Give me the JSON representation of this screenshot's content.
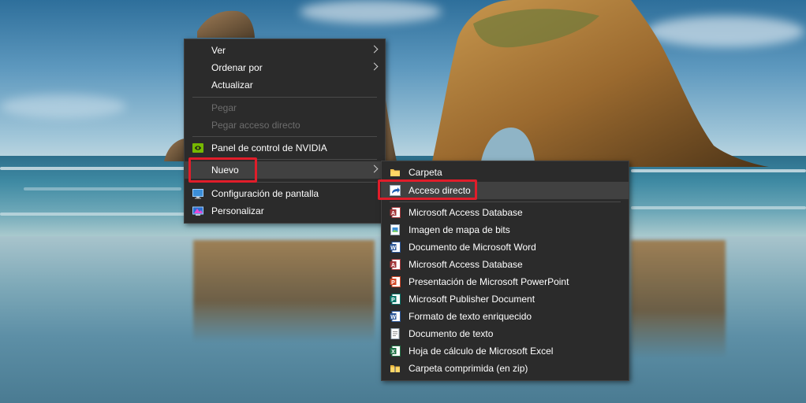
{
  "context_menu": {
    "items": [
      {
        "label": "Ver",
        "submenu": true
      },
      {
        "label": "Ordenar por",
        "submenu": true
      },
      {
        "label": "Actualizar"
      },
      {
        "label": "Pegar",
        "disabled": true
      },
      {
        "label": "Pegar acceso directo",
        "disabled": true
      },
      {
        "label": "Panel de control de NVIDIA",
        "icon": "nvidia-icon"
      },
      {
        "label": "Nuevo",
        "submenu": true,
        "highlighted": true
      },
      {
        "label": "Configuración de pantalla",
        "icon": "display-settings-icon"
      },
      {
        "label": "Personalizar",
        "icon": "personalize-icon"
      }
    ]
  },
  "new_submenu": {
    "items": [
      {
        "label": "Carpeta",
        "icon": "folder-icon"
      },
      {
        "label": "Acceso directo",
        "icon": "shortcut-icon",
        "highlighted": true
      },
      {
        "label": "Microsoft Access Database",
        "icon": "access-icon"
      },
      {
        "label": "Imagen de mapa de bits",
        "icon": "bitmap-icon"
      },
      {
        "label": "Documento de Microsoft Word",
        "icon": "word-icon"
      },
      {
        "label": "Microsoft Access Database",
        "icon": "access-icon"
      },
      {
        "label": "Presentación de Microsoft PowerPoint",
        "icon": "powerpoint-icon"
      },
      {
        "label": "Microsoft Publisher Document",
        "icon": "publisher-icon"
      },
      {
        "label": "Formato de texto enriquecido",
        "icon": "rtf-icon"
      },
      {
        "label": "Documento de texto",
        "icon": "text-document-icon"
      },
      {
        "label": "Hoja de cálculo de Microsoft Excel",
        "icon": "excel-icon"
      },
      {
        "label": "Carpeta comprimida (en zip)",
        "icon": "zip-folder-icon"
      }
    ]
  },
  "colors": {
    "menu_bg": "#2b2b2b",
    "menu_text": "#ffffff",
    "disabled_text": "#6d6d6d",
    "highlight_bg": "#414141",
    "annotation_red": "#e11d2a"
  }
}
